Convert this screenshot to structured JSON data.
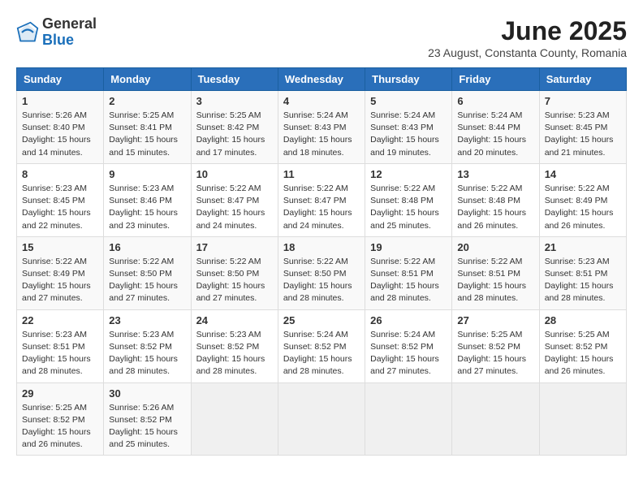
{
  "header": {
    "logo_general": "General",
    "logo_blue": "Blue",
    "title": "June 2025",
    "subtitle": "23 August, Constanta County, Romania"
  },
  "columns": [
    "Sunday",
    "Monday",
    "Tuesday",
    "Wednesday",
    "Thursday",
    "Friday",
    "Saturday"
  ],
  "weeks": [
    [
      {
        "day": "1",
        "info": "Sunrise: 5:26 AM\nSunset: 8:40 PM\nDaylight: 15 hours\nand 14 minutes."
      },
      {
        "day": "2",
        "info": "Sunrise: 5:25 AM\nSunset: 8:41 PM\nDaylight: 15 hours\nand 15 minutes."
      },
      {
        "day": "3",
        "info": "Sunrise: 5:25 AM\nSunset: 8:42 PM\nDaylight: 15 hours\nand 17 minutes."
      },
      {
        "day": "4",
        "info": "Sunrise: 5:24 AM\nSunset: 8:43 PM\nDaylight: 15 hours\nand 18 minutes."
      },
      {
        "day": "5",
        "info": "Sunrise: 5:24 AM\nSunset: 8:43 PM\nDaylight: 15 hours\nand 19 minutes."
      },
      {
        "day": "6",
        "info": "Sunrise: 5:24 AM\nSunset: 8:44 PM\nDaylight: 15 hours\nand 20 minutes."
      },
      {
        "day": "7",
        "info": "Sunrise: 5:23 AM\nSunset: 8:45 PM\nDaylight: 15 hours\nand 21 minutes."
      }
    ],
    [
      {
        "day": "8",
        "info": "Sunrise: 5:23 AM\nSunset: 8:45 PM\nDaylight: 15 hours\nand 22 minutes."
      },
      {
        "day": "9",
        "info": "Sunrise: 5:23 AM\nSunset: 8:46 PM\nDaylight: 15 hours\nand 23 minutes."
      },
      {
        "day": "10",
        "info": "Sunrise: 5:22 AM\nSunset: 8:47 PM\nDaylight: 15 hours\nand 24 minutes."
      },
      {
        "day": "11",
        "info": "Sunrise: 5:22 AM\nSunset: 8:47 PM\nDaylight: 15 hours\nand 24 minutes."
      },
      {
        "day": "12",
        "info": "Sunrise: 5:22 AM\nSunset: 8:48 PM\nDaylight: 15 hours\nand 25 minutes."
      },
      {
        "day": "13",
        "info": "Sunrise: 5:22 AM\nSunset: 8:48 PM\nDaylight: 15 hours\nand 26 minutes."
      },
      {
        "day": "14",
        "info": "Sunrise: 5:22 AM\nSunset: 8:49 PM\nDaylight: 15 hours\nand 26 minutes."
      }
    ],
    [
      {
        "day": "15",
        "info": "Sunrise: 5:22 AM\nSunset: 8:49 PM\nDaylight: 15 hours\nand 27 minutes."
      },
      {
        "day": "16",
        "info": "Sunrise: 5:22 AM\nSunset: 8:50 PM\nDaylight: 15 hours\nand 27 minutes."
      },
      {
        "day": "17",
        "info": "Sunrise: 5:22 AM\nSunset: 8:50 PM\nDaylight: 15 hours\nand 27 minutes."
      },
      {
        "day": "18",
        "info": "Sunrise: 5:22 AM\nSunset: 8:50 PM\nDaylight: 15 hours\nand 28 minutes."
      },
      {
        "day": "19",
        "info": "Sunrise: 5:22 AM\nSunset: 8:51 PM\nDaylight: 15 hours\nand 28 minutes."
      },
      {
        "day": "20",
        "info": "Sunrise: 5:22 AM\nSunset: 8:51 PM\nDaylight: 15 hours\nand 28 minutes."
      },
      {
        "day": "21",
        "info": "Sunrise: 5:23 AM\nSunset: 8:51 PM\nDaylight: 15 hours\nand 28 minutes."
      }
    ],
    [
      {
        "day": "22",
        "info": "Sunrise: 5:23 AM\nSunset: 8:51 PM\nDaylight: 15 hours\nand 28 minutes."
      },
      {
        "day": "23",
        "info": "Sunrise: 5:23 AM\nSunset: 8:52 PM\nDaylight: 15 hours\nand 28 minutes."
      },
      {
        "day": "24",
        "info": "Sunrise: 5:23 AM\nSunset: 8:52 PM\nDaylight: 15 hours\nand 28 minutes."
      },
      {
        "day": "25",
        "info": "Sunrise: 5:24 AM\nSunset: 8:52 PM\nDaylight: 15 hours\nand 28 minutes."
      },
      {
        "day": "26",
        "info": "Sunrise: 5:24 AM\nSunset: 8:52 PM\nDaylight: 15 hours\nand 27 minutes."
      },
      {
        "day": "27",
        "info": "Sunrise: 5:25 AM\nSunset: 8:52 PM\nDaylight: 15 hours\nand 27 minutes."
      },
      {
        "day": "28",
        "info": "Sunrise: 5:25 AM\nSunset: 8:52 PM\nDaylight: 15 hours\nand 26 minutes."
      }
    ],
    [
      {
        "day": "29",
        "info": "Sunrise: 5:25 AM\nSunset: 8:52 PM\nDaylight: 15 hours\nand 26 minutes."
      },
      {
        "day": "30",
        "info": "Sunrise: 5:26 AM\nSunset: 8:52 PM\nDaylight: 15 hours\nand 25 minutes."
      },
      {
        "day": "",
        "info": ""
      },
      {
        "day": "",
        "info": ""
      },
      {
        "day": "",
        "info": ""
      },
      {
        "day": "",
        "info": ""
      },
      {
        "day": "",
        "info": ""
      }
    ]
  ]
}
